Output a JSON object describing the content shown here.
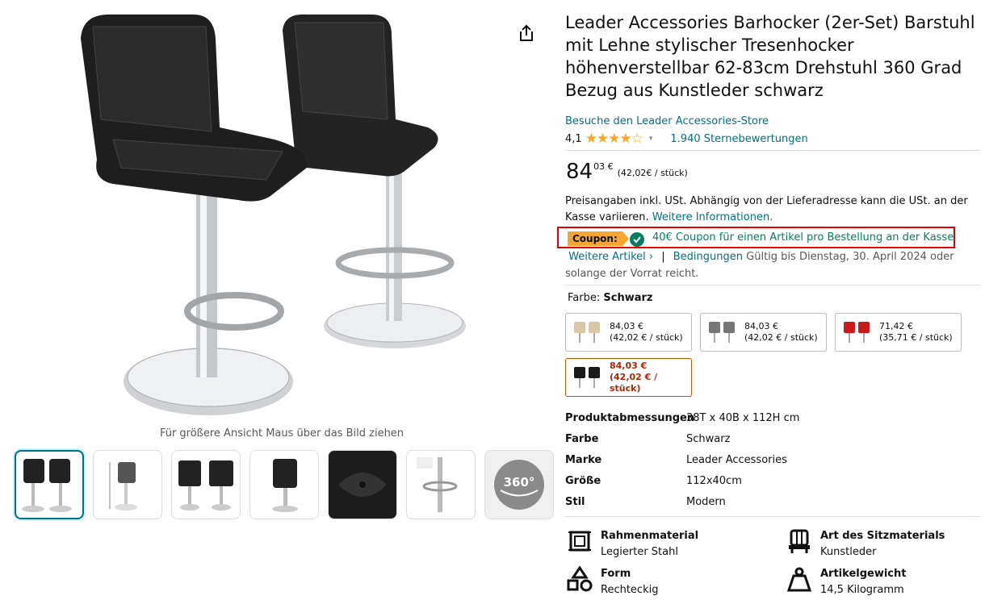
{
  "product": {
    "title": "Leader Accessories Barhocker (2er-Set) Barstuhl mit Lehne stylischer Tresenhocker höhenverstellbar 62-83cm Drehstuhl 360 Grad Bezug aus Kunstleder schwarz",
    "store_link": "Besuche den Leader Accessories-Store",
    "rating_value": "4,1",
    "stars": "★★★★☆",
    "rating_count": "1.940 Sternebewertungen"
  },
  "gallery": {
    "zoom_hint": "Für größere Ansicht Maus über das Bild ziehen",
    "thumb_360_label": "360°"
  },
  "price": {
    "whole": "84",
    "fraction": "03 €",
    "per_unit": "(42,02€ / stück)"
  },
  "tax": {
    "text": "Preisangaben inkl. USt. Abhängig von der Lieferadresse kann die USt. an der Kasse variieren.",
    "link": "Weitere Informationen."
  },
  "coupon": {
    "tag": "Coupon:",
    "text": "40€ Coupon für einen Artikel pro Bestellung an der Kasse",
    "more_items": "Weitere Artikel ›",
    "separator": "|",
    "conditions": "Bedingungen",
    "validity": "Gültig bis Dienstag, 30. April 2024 oder solange der Vorrat reicht."
  },
  "color": {
    "label": "Farbe:",
    "selected": "Schwarz",
    "options": [
      {
        "price": "84,03 €",
        "unit": "(42,02 € / stück)",
        "color_hex": "#d8c8a8"
      },
      {
        "price": "84,03 €",
        "unit": "(42,02 € / stück)",
        "color_hex": "#777777"
      },
      {
        "price": "71,42 €",
        "unit": "(35,71 € / stück)",
        "color_hex": "#cc1a1a"
      },
      {
        "price": "84,03 €",
        "unit": "(42,02 € / stück)",
        "color_hex": "#1a1a1a"
      }
    ]
  },
  "specs": [
    {
      "key": "Produktabmessungen",
      "value": "38T x 40B x 112H cm"
    },
    {
      "key": "Farbe",
      "value": "Schwarz"
    },
    {
      "key": "Marke",
      "value": "Leader Accessories"
    },
    {
      "key": "Größe",
      "value": "112x40cm"
    },
    {
      "key": "Stil",
      "value": "Modern"
    }
  ],
  "features": [
    {
      "key": "Rahmenmaterial",
      "value": "Legierter Stahl",
      "icon": "frame-icon"
    },
    {
      "key": "Art des Sitzmaterials",
      "value": "Kunstleder",
      "icon": "seat-material-icon"
    },
    {
      "key": "Form",
      "value": "Rechteckig",
      "icon": "shapes-icon"
    },
    {
      "key": "Artikelgewicht",
      "value": "14,5 Kilogramm",
      "icon": "weight-icon"
    }
  ],
  "colors": {
    "link": "#007185",
    "price_red": "#b12704",
    "coupon_green": "#067d62",
    "coupon_orange": "#f7a531",
    "star": "#ffa41c"
  }
}
